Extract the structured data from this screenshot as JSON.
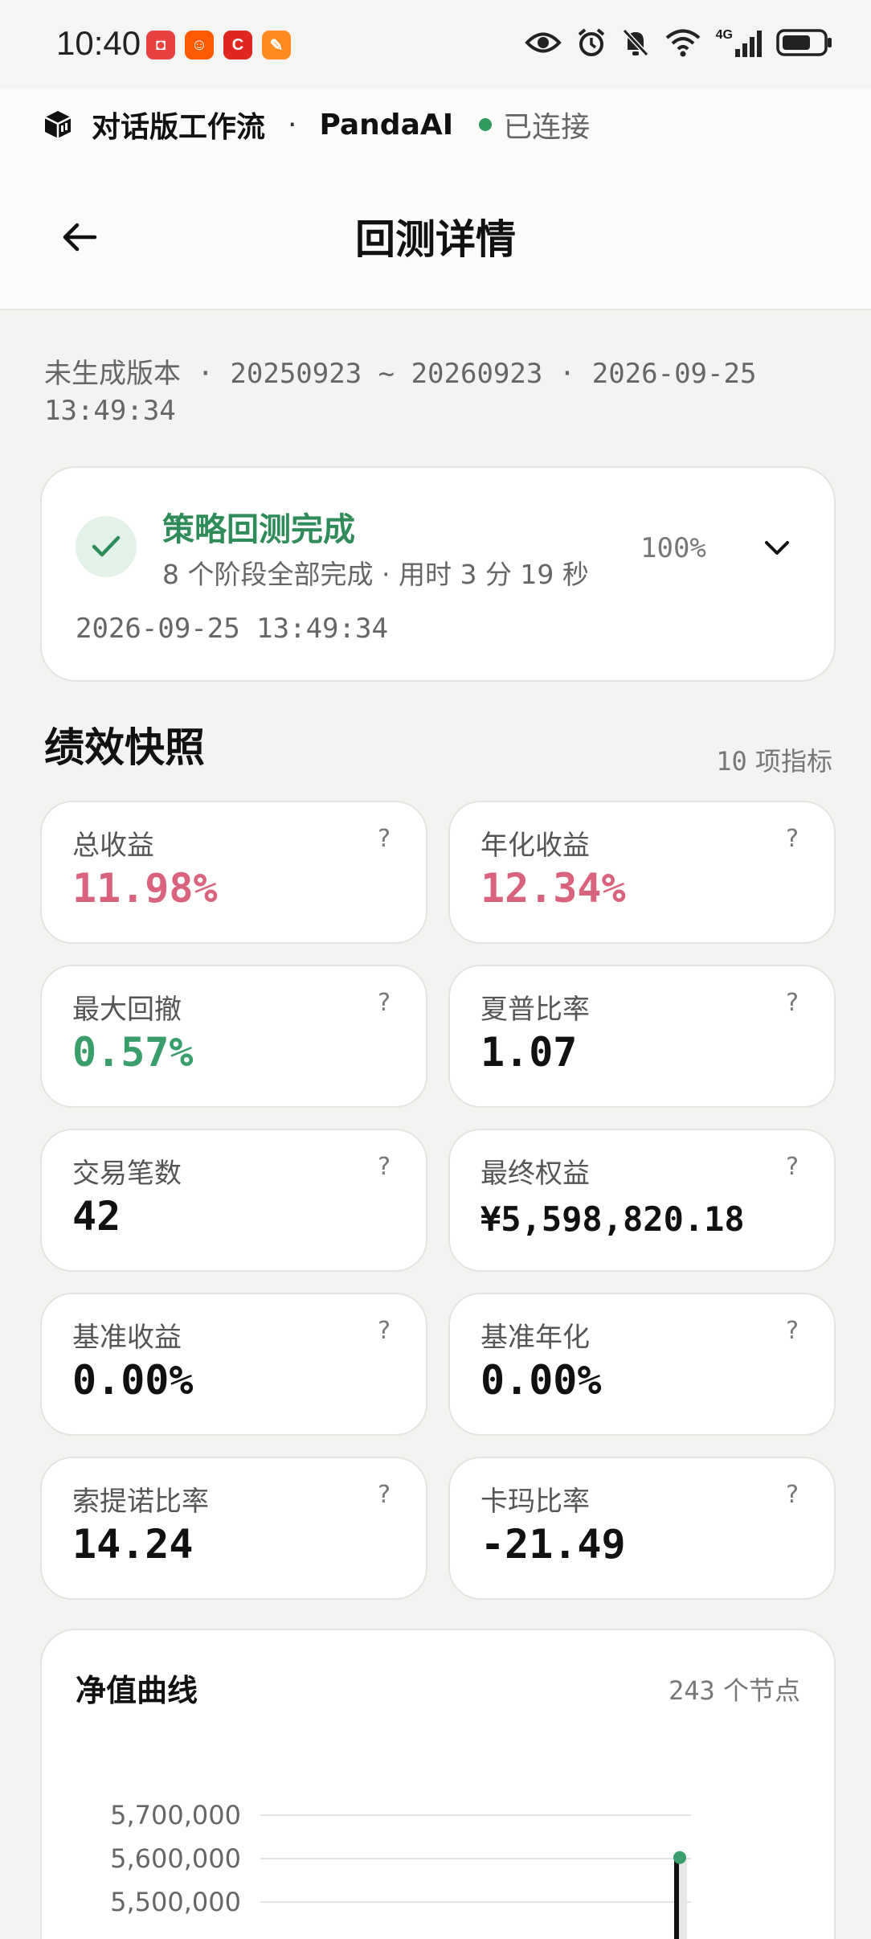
{
  "status_bar": {
    "time": "10:40",
    "apps": [
      {
        "icon": "huawei-store-icon",
        "color": "#e8413f",
        "glyph": "◘"
      },
      {
        "icon": "taobao-icon",
        "color": "#ff5a00",
        "glyph": "☺"
      },
      {
        "icon": "c-app-icon",
        "color": "#e0271f",
        "glyph": "C"
      },
      {
        "icon": "fenbi-icon",
        "color": "#ff8a1e",
        "glyph": "✎"
      }
    ],
    "network": "4G"
  },
  "workflow": {
    "title": "对话版工作流",
    "separator": "·",
    "app_name": "PandaAI",
    "status": "已连接",
    "status_color": "#2f9c5d"
  },
  "header": {
    "title": "回测详情"
  },
  "meta": {
    "text": "未生成版本 · 20250923 ~ 20260923 · 2026-09-25 13:49:34"
  },
  "progress": {
    "title": "策略回测完成",
    "subtitle": "8 个阶段全部完成 · 用时 3 分 19 秒",
    "percent": "100%",
    "timestamp": "2026-09-25 13:49:34",
    "accent": "#2f8c58"
  },
  "performance": {
    "title": "绩效快照",
    "count": "10",
    "count_suffix": "项指标",
    "help_glyph": "?",
    "metrics": [
      {
        "label": "总收益",
        "value": "11.98%",
        "color": "#d9627c"
      },
      {
        "label": "年化收益",
        "value": "12.34%",
        "color": "#d9627c"
      },
      {
        "label": "最大回撤",
        "value": "0.57%",
        "color": "#3a9e6b"
      },
      {
        "label": "夏普比率",
        "value": "1.07",
        "color": "#111111"
      },
      {
        "label": "交易笔数",
        "value": "42",
        "color": "#111111"
      },
      {
        "label": "最终权益",
        "value": "¥5,598,820.18",
        "color": "#111111"
      },
      {
        "label": "基准收益",
        "value": "0.00%",
        "color": "#111111"
      },
      {
        "label": "基准年化",
        "value": "0.00%",
        "color": "#111111"
      },
      {
        "label": "索提诺比率",
        "value": "14.24",
        "color": "#111111"
      },
      {
        "label": "卡玛比率",
        "value": "-21.49",
        "color": "#111111"
      }
    ]
  },
  "chart_data": {
    "type": "line",
    "title": "净值曲线",
    "node_count": "243",
    "node_suffix": "个节点",
    "y_ticks": [
      "5,700,000",
      "5,600,000",
      "5,500,000"
    ],
    "y_tick_values": [
      5700000,
      5600000,
      5500000
    ],
    "grid": true,
    "line_color": "#111111",
    "marker_color": "#3a9e6b",
    "last_value": 5598820.18
  }
}
